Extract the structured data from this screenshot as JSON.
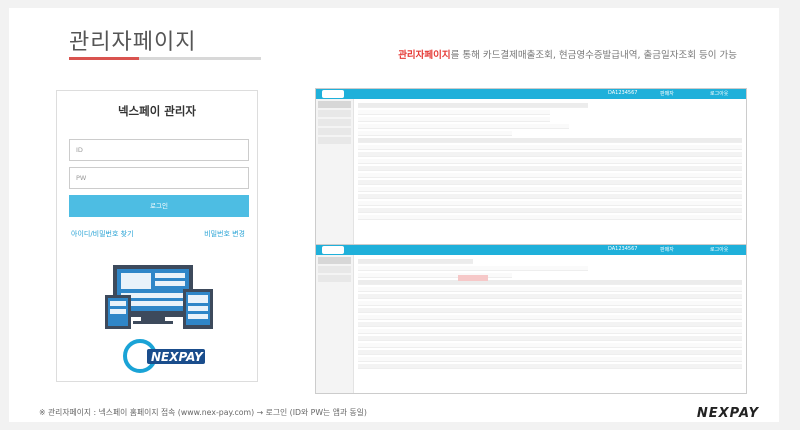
{
  "page": {
    "title": "관리자페이지",
    "subtitle_highlight": "관리자페이지",
    "subtitle_rest": "를 통해 카드결제매출조회, 현금영수증발급내역, 출금일자조회 등이 가능",
    "footnote": "※ 관리자페이지 : 넥스페이 홈페이지 접속 (www.nex-pay.com) → 로그인 (ID와 PW는 앱과 동일)",
    "brand": "NEXPAY"
  },
  "login": {
    "title": "넥스페이 관리자",
    "id_placeholder": "ID",
    "pw_placeholder": "PW",
    "button": "로그인",
    "find_link": "아이디/비밀번호 찾기",
    "change_link": "비밀번호 변경"
  },
  "logo": {
    "text": "NEXPAY",
    "accent": "#1aa3d6"
  },
  "screens": {
    "top_id": "DA1234567",
    "top_status": "판매자",
    "top_logout": "로그아웃"
  },
  "colors": {
    "accent": "#4dbde3",
    "red": "#d9534f",
    "header": "#1fb0da"
  }
}
